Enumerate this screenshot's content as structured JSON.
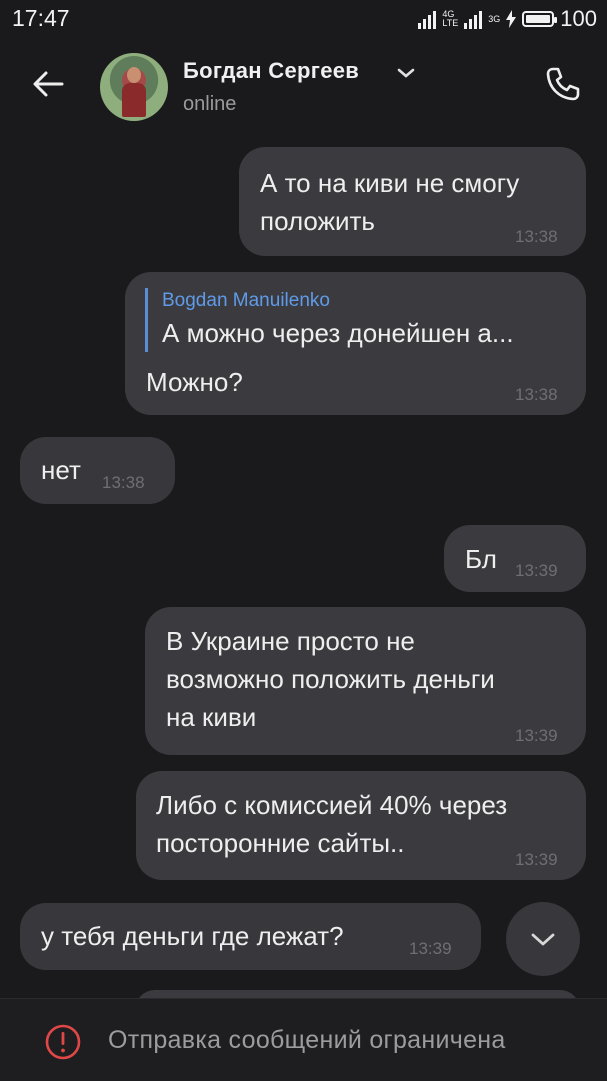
{
  "status_bar": {
    "time": "17:47",
    "network_1": "4G",
    "network_1_sub": "LTE",
    "network_2": "3G",
    "battery": "100",
    "battery_level_percent": 100
  },
  "header": {
    "contact_name": "Богдан Сергеев",
    "presence": "online",
    "icons": [
      "back-arrow-icon",
      "chevron-down-icon",
      "phone-icon"
    ]
  },
  "messages": [
    {
      "direction": "out",
      "lines": [
        "А то на киви не смогу",
        "положить"
      ],
      "time": "13:38"
    },
    {
      "direction": "out",
      "quote_author": "Bogdan Manuilenko",
      "quote_text": "А можно через донейшен а...",
      "lines": [
        "Можно?"
      ],
      "time": "13:38"
    },
    {
      "direction": "in",
      "lines": [
        "нет"
      ],
      "time": "13:38"
    },
    {
      "direction": "out",
      "lines": [
        "Бл"
      ],
      "time": "13:39"
    },
    {
      "direction": "out",
      "lines": [
        "В Украине просто не",
        "возможно положить деньги",
        "на киви"
      ],
      "time": "13:39"
    },
    {
      "direction": "out",
      "lines": [
        "Либо с комиссией 40% через",
        "посторонние сайты.."
      ],
      "time": "13:39"
    },
    {
      "direction": "in",
      "lines": [
        "у тебя деньги где лежат?"
      ],
      "time": "13:39"
    }
  ],
  "scroll_down_icon": "chevron-down-icon",
  "bottom_bar": {
    "notice": "Отправка сообщений ограничена",
    "icon": "exclamation-circle-icon",
    "icon_color": "#e04848"
  }
}
